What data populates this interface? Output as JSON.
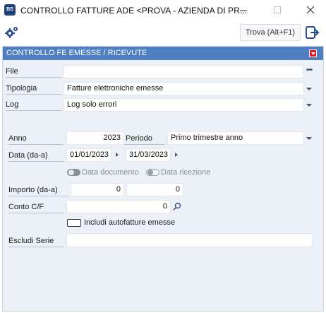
{
  "window": {
    "title": "CONTROLLO FATTURE ADE <PROVA - AZIENDA DI PR...",
    "app_icon_text": "BS",
    "app_icon": "app-logo-icon",
    "minimize_icon": "minimize-icon",
    "maximize_icon": "maximize-icon",
    "close_icon": "close-icon"
  },
  "toolbar": {
    "settings_icon": "gear-icon",
    "search_label": "Trova (Alt+F1)",
    "exit_icon": "exit-icon"
  },
  "panel": {
    "title": "CONTROLLO FE EMESSE / RICEVUTE",
    "collapse_icon": "collapse-icon",
    "accent_color": "#4f7fc0",
    "collapse_color": "#e3141a"
  },
  "form": {
    "file": {
      "label": "File",
      "value": "",
      "browse_icon": "ellipsis-icon"
    },
    "tipologia": {
      "label": "Tipologia",
      "value": "Fatture elettroniche emesse"
    },
    "log": {
      "label": "Log",
      "value": "Log solo errori"
    },
    "anno": {
      "label": "Anno",
      "value": "2023"
    },
    "periodo": {
      "label": "Periodo",
      "value": "Primo trimestre anno"
    },
    "data": {
      "label": "Data  (da-a)",
      "from": "01/01/2023",
      "to": "31/03/2023"
    },
    "toggle_documento": {
      "label": "Data documento",
      "on": false
    },
    "toggle_ricezione": {
      "label": "Data ricezione",
      "on": false
    },
    "importo": {
      "label": "Importo (da-a)",
      "from": "0",
      "to": "0"
    },
    "conto": {
      "label": "Conto  C/F",
      "value": "0",
      "lookup_icon": "search-icon"
    },
    "autofatture": {
      "label": "Includi autofatture emesse",
      "checked": false
    },
    "escludi_serie": {
      "label": "Escludi Serie",
      "value": ""
    }
  }
}
